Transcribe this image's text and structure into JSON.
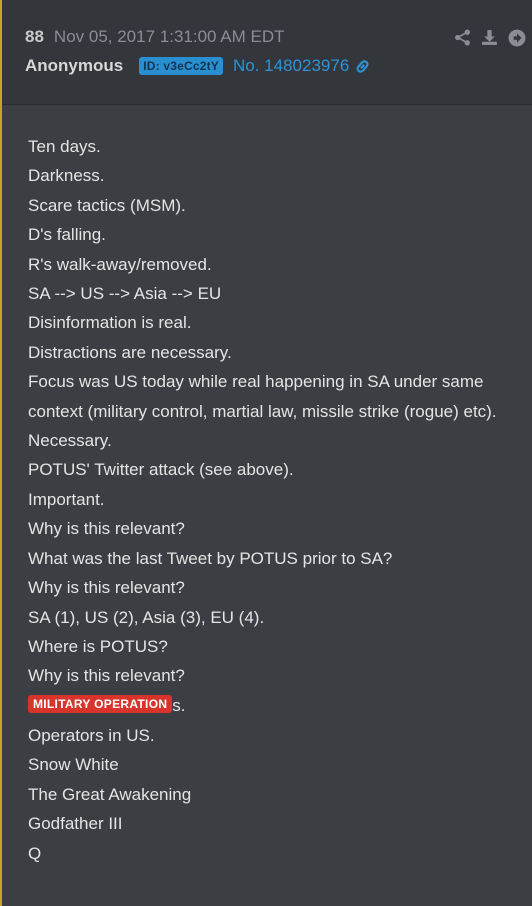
{
  "header": {
    "post_number": "88",
    "timestamp": "Nov 05, 2017 1:31:00 AM EDT",
    "author": "Anonymous",
    "id_badge": "ID: v3eCc2tY",
    "post_no_link": "No. 148023976"
  },
  "actions": {
    "share_icon": "share-icon",
    "download_icon": "download-icon",
    "goto_icon": "arrow-right-circle-icon"
  },
  "colors": {
    "background": "#3b3f44",
    "header_background": "#33363a",
    "accent_blue": "#2e93d8",
    "id_badge_bg": "#2a8fd1",
    "redaction_red": "#d9342b",
    "left_border": "#c9a227"
  },
  "body": {
    "lines": [
      "Ten days.",
      "Darkness.",
      "Scare tactics (MSM).",
      "D's falling.",
      "R's walk-away/removed.",
      "SA --> US --> Asia --> EU",
      "Disinformation is real.",
      "Distractions are necessary.",
      "Focus was US today while real happening in SA under same context (military control, martial law, missile strike (rogue) etc).",
      "Necessary.",
      "POTUS' Twitter attack (see above).",
      "Important.",
      "Why is this relevant?",
      "What was the last Tweet by POTUS prior to SA?",
      "Why is this relevant?",
      "SA (1), US (2), Asia (3), EU (4).",
      "Where is POTUS?",
      "Why is this relevant?"
    ],
    "redacted_label": "MILITARY OPERATION",
    "redacted_suffix": "s.",
    "lines_after": [
      "Operators in US.",
      "Snow White",
      "The Great Awakening",
      "Godfather III",
      "Q"
    ]
  }
}
